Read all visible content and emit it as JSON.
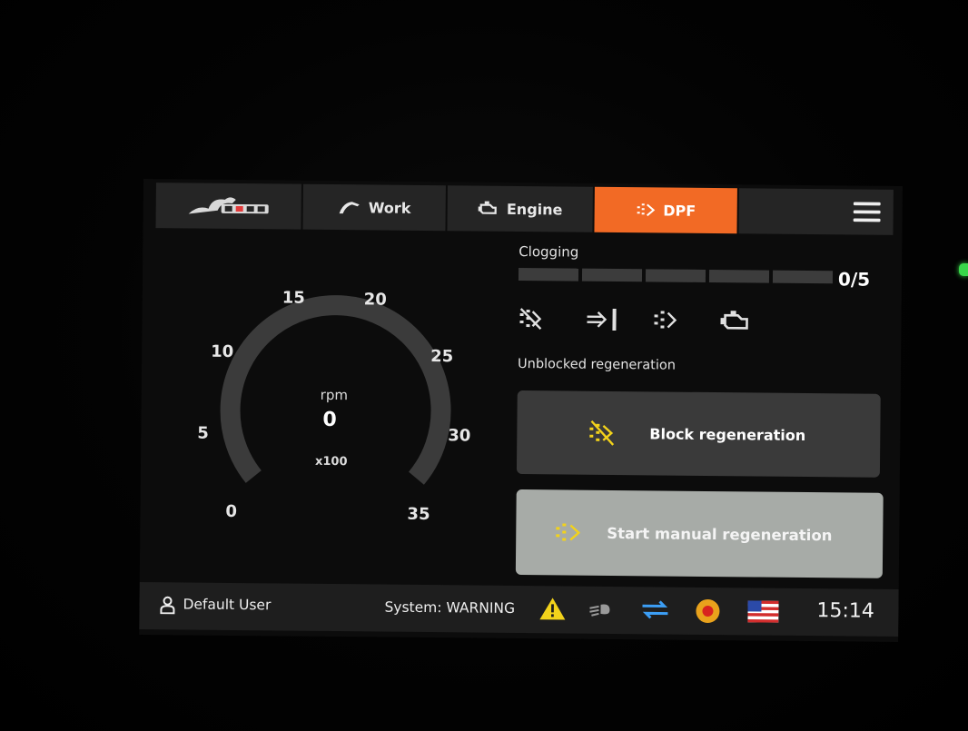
{
  "nav": {
    "tabs": [
      {
        "label": "",
        "icon": "brand-logo"
      },
      {
        "label": "Work",
        "icon": "excavator-arm-icon"
      },
      {
        "label": "Engine",
        "icon": "engine-icon"
      },
      {
        "label": "DPF",
        "icon": "dpf-icon",
        "active": true
      }
    ],
    "menu_icon": "hamburger-menu-icon"
  },
  "gauge": {
    "ticks": [
      "0",
      "5",
      "10",
      "15",
      "20",
      "25",
      "30",
      "35"
    ],
    "unit": "rpm",
    "value": "0",
    "multiplier": "x100"
  },
  "dpf": {
    "clogging_label": "Clogging",
    "clogging_level": 0,
    "clogging_max": 5,
    "clogging_text": "0/5",
    "status_icons": [
      "regeneration-blocked-icon",
      "exhaust-temperature-icon",
      "dpf-filter-icon",
      "engine-check-icon"
    ],
    "regen_status": "Unblocked regeneration",
    "block_button": "Block regeneration",
    "start_button": "Start manual regeneration"
  },
  "statusbar": {
    "user": "Default User",
    "system": "System: WARNING",
    "icons": [
      "warning-icon",
      "work-light-icon",
      "data-transfer-icon",
      "emergency-stop-icon",
      "us-flag-icon"
    ],
    "time": "15:14"
  },
  "colors": {
    "accent": "#f26a25",
    "warning": "#f2d21b",
    "transfer": "#3c9ef5",
    "estop": "#e9a21c"
  }
}
